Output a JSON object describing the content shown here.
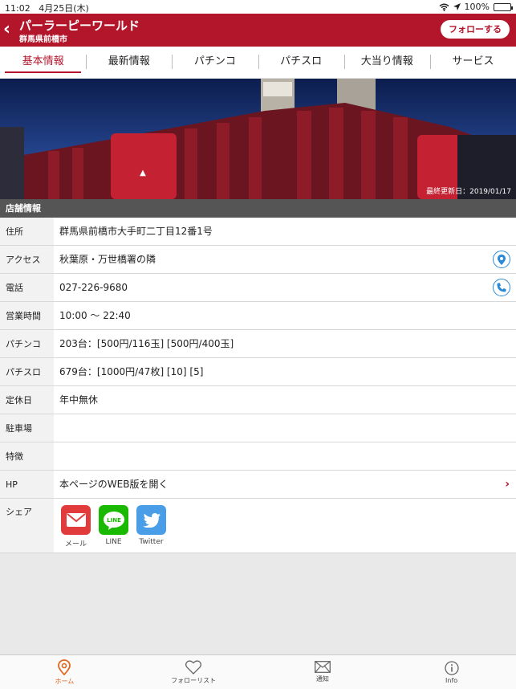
{
  "status": {
    "time": "11:02",
    "date": "4月25日(木)",
    "battery": "100%"
  },
  "header": {
    "title": "パーラーピーワールド",
    "subtitle": "群馬県前橋市",
    "follow_label": "フォローする"
  },
  "tabs": [
    {
      "label": "基本情報"
    },
    {
      "label": "最新情報"
    },
    {
      "label": "パチンコ"
    },
    {
      "label": "パチスロ"
    },
    {
      "label": "大当り情報"
    },
    {
      "label": "サービス"
    }
  ],
  "hero": {
    "updated": "最終更新日：2019/01/17"
  },
  "section": {
    "title": "店舗情報"
  },
  "rows": {
    "address": {
      "label": "住所",
      "value": "群馬県前橋市大手町二丁目12番1号"
    },
    "access": {
      "label": "アクセス",
      "value": "秋葉原・万世橋署の隣"
    },
    "phone": {
      "label": "電話",
      "value": "027-226-9680"
    },
    "hours": {
      "label": "営業時間",
      "value": "10:00 〜 22:40"
    },
    "pachinko": {
      "label": "パチンコ",
      "value": "203台：[500円/116玉] [500円/400玉]"
    },
    "pachislo": {
      "label": "パチスロ",
      "value": "679台：[1000円/47枚] [10] [5]"
    },
    "holiday": {
      "label": "定休日",
      "value": "年中無休"
    },
    "parking": {
      "label": "駐車場",
      "value": ""
    },
    "features": {
      "label": "特徴",
      "value": ""
    },
    "hp": {
      "label": "HP",
      "value": "本ページのWEB版を開く"
    },
    "share": {
      "label": "シェア",
      "mail": "メール",
      "line": "LINE",
      "twitter": "Twitter",
      "line_icon_text": "LINE"
    }
  },
  "colors": {
    "brand": "#b3162b",
    "accent_blue": "#2a8ad8",
    "line": "#18b900",
    "twitter": "#4a9ee8",
    "mail": "#e23b3b",
    "active_tab": "#e2661e"
  },
  "tabbar": {
    "home": "ホーム",
    "follow_list": "フォローリスト",
    "notice": "通知",
    "info": "Info"
  }
}
